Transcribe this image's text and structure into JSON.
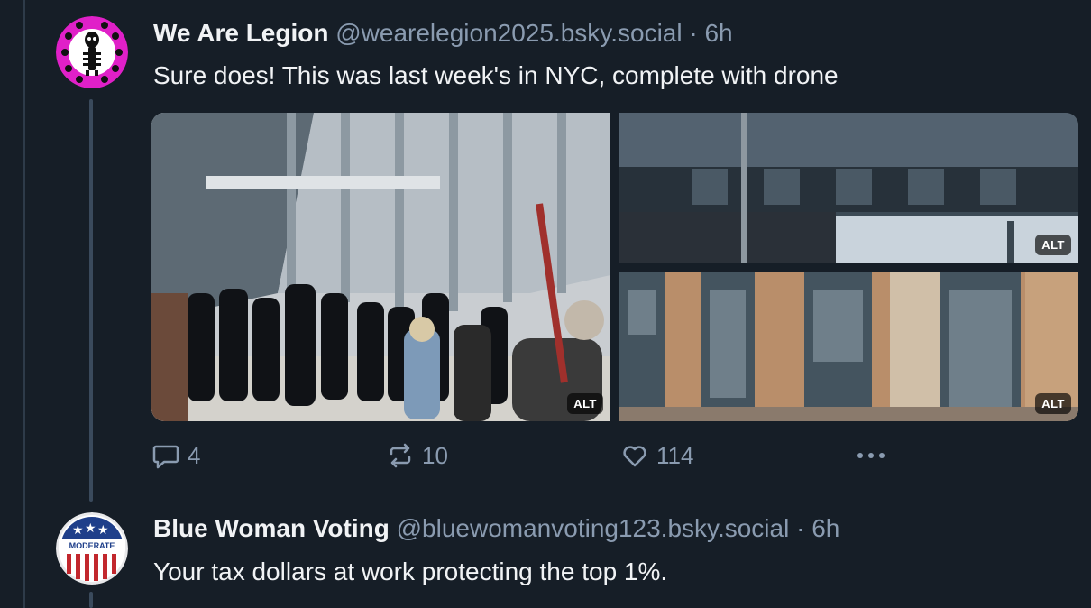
{
  "posts": [
    {
      "author": "We Are Legion",
      "handle": "@wearelegion2025.bsky.social",
      "separator": "·",
      "time": "6h",
      "text": "Sure does! This was last week's in NYC, complete with drone",
      "images": [
        {
          "alt_label": "ALT"
        },
        {
          "alt_label": "ALT"
        },
        {
          "alt_label": "ALT"
        }
      ],
      "actions": {
        "replies": "4",
        "reposts": "10",
        "likes": "114"
      }
    },
    {
      "author": "Blue Woman Voting",
      "handle": "@bluewomanvoting123.bsky.social",
      "separator": "·",
      "time": "6h",
      "text": "Your tax dollars at work protecting the top 1%.",
      "avatar_badge": "MODERATE"
    }
  ],
  "icons": {
    "reply": "speech-bubble-icon",
    "repost": "repost-arrows-icon",
    "like": "heart-icon",
    "more": "ellipsis-icon"
  },
  "colors": {
    "background": "#161e27",
    "muted_text": "#8a9bb0",
    "thread_line": "#3a4a5c",
    "avatar_magenta": "#e020c8"
  }
}
